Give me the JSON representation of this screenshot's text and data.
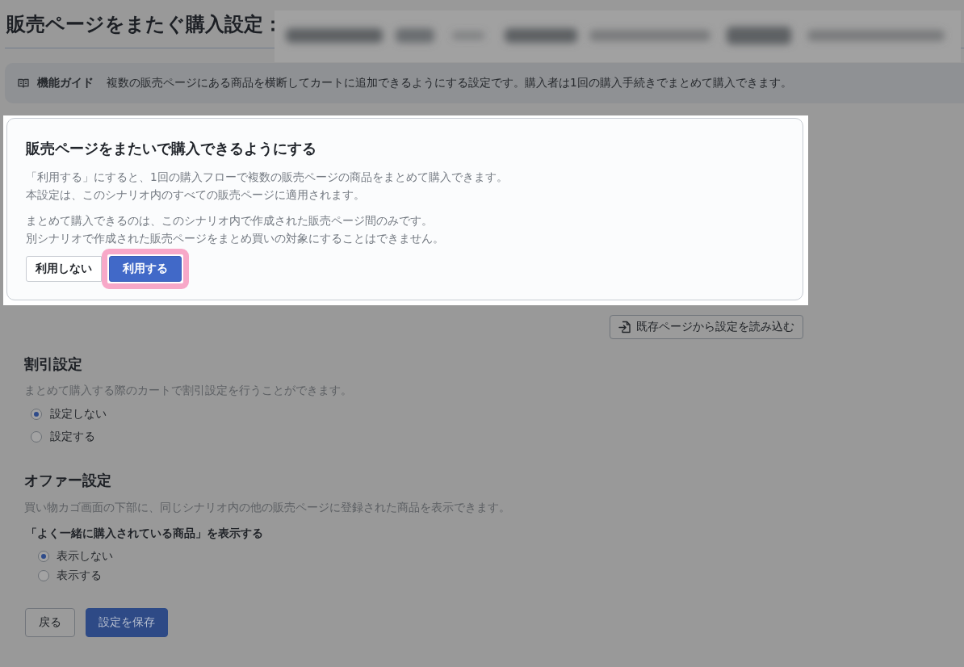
{
  "page": {
    "title": "販売ページをまたぐ購入設定：",
    "name_blurred": true
  },
  "feature_guide": {
    "label": "機能ガイド",
    "text": "複数の販売ページにある商品を横断してカートに追加できるようにする設定です。購入者は1回の購入手続きでまとめて購入できます。"
  },
  "cross_page_purchase": {
    "spotlighted": true,
    "title": "販売ページをまたいで購入できるようにする",
    "paragraphs": [
      [
        "「利用する」にすると、1回の購入フローで複数の販売ページの商品をまとめて購入できます。",
        "本設定は、このシナリオ内のすべての販売ページに適用されます。"
      ],
      [
        "まとめて購入できるのは、このシナリオ内で作成された販売ページ間のみです。",
        "別シナリオで作成された販売ページをまとめ買いの対象にすることはできません。"
      ]
    ],
    "options": [
      {
        "label": "利用しない",
        "selected": false,
        "highlighted": false
      },
      {
        "label": "利用する",
        "selected": true,
        "highlighted": true
      }
    ]
  },
  "import_button": {
    "label": "既存ページから設定を読み込む"
  },
  "discount_settings": {
    "title": "割引設定",
    "description": "まとめて購入する際のカートで割引設定を行うことができます。",
    "options": [
      {
        "label": "設定しない",
        "selected": true
      },
      {
        "label": "設定する",
        "selected": false
      }
    ]
  },
  "offer_settings": {
    "title": "オファー設定",
    "description": "買い物カゴ画面の下部に、同じシナリオ内の他の販売ページに登録された商品を表示できます。",
    "question": "「よく一緒に購入されている商品」を表示する",
    "options": [
      {
        "label": "表示しない",
        "selected": true
      },
      {
        "label": "表示する",
        "selected": false
      }
    ]
  },
  "footer_buttons": [
    {
      "label": "戻る",
      "kind": "secondary"
    },
    {
      "label": "設定を保存",
      "kind": "primary"
    }
  ]
}
